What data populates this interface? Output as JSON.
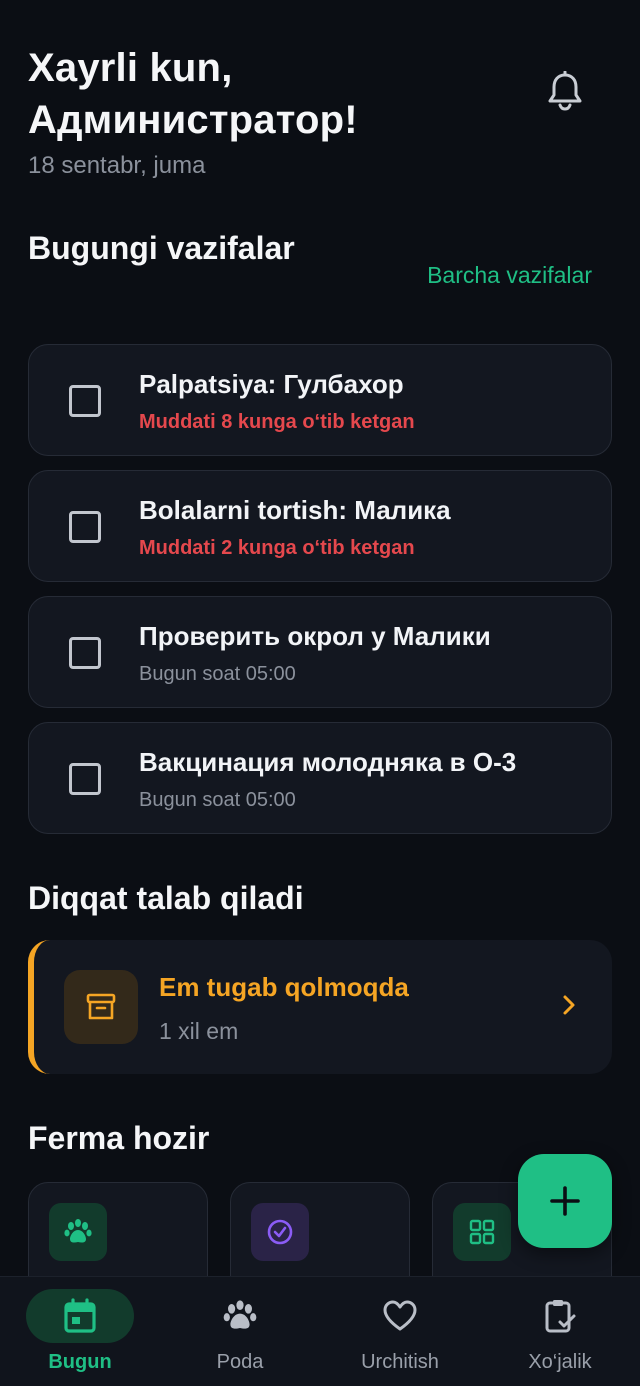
{
  "header": {
    "greeting_line1": "Xayrli kun,",
    "greeting_line2": "Администратор!",
    "date": "18 sentabr, juma",
    "notification_icon": "bell-icon"
  },
  "tasks_section": {
    "title": "Bugungi vazifalar",
    "see_all": "Barcha vazifalar",
    "items": [
      {
        "title": "Palpatsiya: Гулбахор",
        "subtitle": "Muddati 8 kunga o‘tib ketgan",
        "overdue": true
      },
      {
        "title": "Bolalarni tortish: Малика",
        "subtitle": "Muddati 2 kunga o‘tib ketgan",
        "overdue": true
      },
      {
        "title": "Проверить окрол у Малики",
        "subtitle": "Bugun soat 05:00",
        "overdue": false
      },
      {
        "title": "Вакцинация молодняка в О-3",
        "subtitle": "Bugun soat 05:00",
        "overdue": false
      }
    ]
  },
  "attention_section": {
    "title": "Diqqat talab qiladi",
    "card": {
      "icon": "archive-box-icon",
      "title": "Em tugab qolmoqda",
      "subtitle": "1 xil em",
      "accent": "#f5a524"
    }
  },
  "farm_section": {
    "title": "Ferma hozir",
    "cards": [
      {
        "icon": "paw-icon",
        "color": "#1fbf85"
      },
      {
        "icon": "check-circle-icon",
        "color": "#8b5cf6"
      },
      {
        "icon": "grid-icon",
        "color": "#1fbf85"
      }
    ]
  },
  "fab": {
    "icon": "plus-icon"
  },
  "bottom_nav": {
    "items": [
      {
        "label": "Bugun",
        "icon": "calendar-icon",
        "active": true
      },
      {
        "label": "Poda",
        "icon": "paw-icon",
        "active": false
      },
      {
        "label": "Urchitish",
        "icon": "heart-icon",
        "active": false
      },
      {
        "label": "Xo‘jalik",
        "icon": "clipboard-check-icon",
        "active": false
      }
    ]
  },
  "colors": {
    "background": "#0b0e14",
    "card": "#131720",
    "accent_green": "#1fbf85",
    "overdue_red": "#e5484d",
    "warning_orange": "#f5a524"
  }
}
